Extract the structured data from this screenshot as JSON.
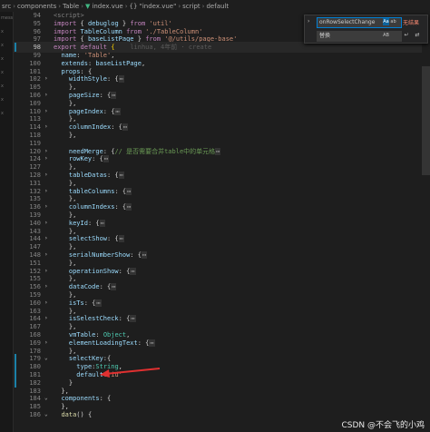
{
  "breadcrumb": [
    "src",
    "components",
    "Table",
    "index.vue",
    "{} \"index.vue\"",
    "script",
    "default"
  ],
  "sidebar_text": [
    "messa",
    "x",
    "x",
    "x",
    "x",
    "x",
    "x",
    "x"
  ],
  "find_widget": {
    "search_value": "onRowSelectChange",
    "options": [
      "Aa",
      "ab",
      ".*"
    ],
    "status": "无结果",
    "replace_value": "替换",
    "replace_options": [
      "AB"
    ]
  },
  "lines": [
    {
      "n": "94",
      "tokens": [
        [
          "tag",
          "<script>"
        ]
      ]
    },
    {
      "n": "95",
      "tokens": [
        [
          "kw",
          "import"
        ],
        [
          "punc",
          " { "
        ],
        [
          "var",
          "debuglog"
        ],
        [
          "punc",
          " } "
        ],
        [
          "kw",
          "from"
        ],
        [
          "punc",
          " "
        ],
        [
          "str",
          "'util'"
        ]
      ]
    },
    {
      "n": "96",
      "tokens": [
        [
          "kw",
          "import"
        ],
        [
          "punc",
          " "
        ],
        [
          "var",
          "TableColumn"
        ],
        [
          "punc",
          " "
        ],
        [
          "kw",
          "from"
        ],
        [
          "punc",
          " "
        ],
        [
          "str",
          "'./TableColumn'"
        ]
      ]
    },
    {
      "n": "97",
      "tokens": [
        [
          "kw",
          "import"
        ],
        [
          "punc",
          " { "
        ],
        [
          "var",
          "baseListPage"
        ],
        [
          "punc",
          " } "
        ],
        [
          "kw",
          "from"
        ],
        [
          "punc",
          " "
        ],
        [
          "str",
          "'@/utils/page-base'"
        ]
      ]
    },
    {
      "n": "98",
      "cur": true,
      "tokens": [
        [
          "kw",
          "export"
        ],
        [
          "punc",
          " "
        ],
        [
          "kw",
          "default"
        ],
        [
          "punc",
          " "
        ],
        [
          "b1",
          "{"
        ],
        [
          "ghost",
          "    linhua, 4年前 · create"
        ]
      ]
    },
    {
      "n": "99",
      "tokens": [
        [
          "punc",
          "  "
        ],
        [
          "var",
          "name"
        ],
        [
          "punc",
          ": "
        ],
        [
          "str",
          "'Table'"
        ],
        [
          "punc",
          ","
        ]
      ]
    },
    {
      "n": "100",
      "tokens": [
        [
          "punc",
          "  "
        ],
        [
          "var",
          "extends"
        ],
        [
          "punc",
          ": "
        ],
        [
          "var",
          "baseListPage"
        ],
        [
          "punc",
          ","
        ]
      ]
    },
    {
      "n": "101",
      "tokens": [
        [
          "punc",
          "  "
        ],
        [
          "var",
          "props"
        ],
        [
          "punc",
          ": {"
        ]
      ]
    },
    {
      "n": "102",
      "fold": ">",
      "tokens": [
        [
          "punc",
          "    "
        ],
        [
          "var",
          "widthStyle"
        ],
        [
          "punc",
          ": {"
        ],
        [
          "coll",
          "⋯"
        ]
      ]
    },
    {
      "n": "105",
      "tokens": [
        [
          "punc",
          "    },"
        ]
      ]
    },
    {
      "n": "106",
      "fold": ">",
      "tokens": [
        [
          "punc",
          "    "
        ],
        [
          "var",
          "pageSize"
        ],
        [
          "punc",
          ": {"
        ],
        [
          "coll",
          "⋯"
        ]
      ]
    },
    {
      "n": "109",
      "tokens": [
        [
          "punc",
          "    },"
        ]
      ]
    },
    {
      "n": "110",
      "fold": ">",
      "tokens": [
        [
          "punc",
          "    "
        ],
        [
          "var",
          "pageIndex"
        ],
        [
          "punc",
          ": {"
        ],
        [
          "coll",
          "⋯"
        ]
      ]
    },
    {
      "n": "113",
      "tokens": [
        [
          "punc",
          "    },"
        ]
      ]
    },
    {
      "n": "114",
      "fold": ">",
      "tokens": [
        [
          "punc",
          "    "
        ],
        [
          "var",
          "columnIndex"
        ],
        [
          "punc",
          ": {"
        ],
        [
          "coll",
          "⋯"
        ]
      ]
    },
    {
      "n": "118",
      "tokens": [
        [
          "punc",
          "    },"
        ]
      ]
    },
    {
      "n": "119",
      "tokens": []
    },
    {
      "n": "120",
      "fold": ">",
      "tokens": [
        [
          "punc",
          "    "
        ],
        [
          "var",
          "needMerge"
        ],
        [
          "punc",
          ": {"
        ],
        [
          "cmt",
          "// 是否需要合并table中的单元格"
        ],
        [
          "coll",
          "⋯"
        ]
      ]
    },
    {
      "n": "124",
      "fold": ">",
      "tokens": [
        [
          "punc",
          "    "
        ],
        [
          "var",
          "rowKey"
        ],
        [
          "punc",
          ": {"
        ],
        [
          "coll",
          "⋯"
        ]
      ]
    },
    {
      "n": "127",
      "tokens": [
        [
          "punc",
          "    },"
        ]
      ]
    },
    {
      "n": "128",
      "fold": ">",
      "tokens": [
        [
          "punc",
          "    "
        ],
        [
          "var",
          "tableDatas"
        ],
        [
          "punc",
          ": {"
        ],
        [
          "coll",
          "⋯"
        ]
      ]
    },
    {
      "n": "131",
      "tokens": [
        [
          "punc",
          "    },"
        ]
      ]
    },
    {
      "n": "132",
      "fold": ">",
      "tokens": [
        [
          "punc",
          "    "
        ],
        [
          "var",
          "tableColumns"
        ],
        [
          "punc",
          ": {"
        ],
        [
          "coll",
          "⋯"
        ]
      ]
    },
    {
      "n": "135",
      "tokens": [
        [
          "punc",
          "    },"
        ]
      ]
    },
    {
      "n": "136",
      "fold": ">",
      "tokens": [
        [
          "punc",
          "    "
        ],
        [
          "var",
          "columnIndexs"
        ],
        [
          "punc",
          ": {"
        ],
        [
          "coll",
          "⋯"
        ]
      ]
    },
    {
      "n": "139",
      "tokens": [
        [
          "punc",
          "    },"
        ]
      ]
    },
    {
      "n": "140",
      "fold": ">",
      "tokens": [
        [
          "punc",
          "    "
        ],
        [
          "var",
          "keyId"
        ],
        [
          "punc",
          ": {"
        ],
        [
          "coll",
          "⋯"
        ]
      ]
    },
    {
      "n": "143",
      "tokens": [
        [
          "punc",
          "    },"
        ]
      ]
    },
    {
      "n": "144",
      "fold": ">",
      "tokens": [
        [
          "punc",
          "    "
        ],
        [
          "var",
          "selectShow"
        ],
        [
          "punc",
          ": {"
        ],
        [
          "coll",
          "⋯"
        ]
      ]
    },
    {
      "n": "147",
      "tokens": [
        [
          "punc",
          "    },"
        ]
      ]
    },
    {
      "n": "148",
      "fold": ">",
      "tokens": [
        [
          "punc",
          "    "
        ],
        [
          "var",
          "serialNumberShow"
        ],
        [
          "punc",
          ": {"
        ],
        [
          "coll",
          "⋯"
        ]
      ]
    },
    {
      "n": "151",
      "tokens": [
        [
          "punc",
          "    },"
        ]
      ]
    },
    {
      "n": "152",
      "fold": ">",
      "tokens": [
        [
          "punc",
          "    "
        ],
        [
          "var",
          "operationShow"
        ],
        [
          "punc",
          ": {"
        ],
        [
          "coll",
          "⋯"
        ]
      ]
    },
    {
      "n": "155",
      "tokens": [
        [
          "punc",
          "    },"
        ]
      ]
    },
    {
      "n": "156",
      "fold": ">",
      "tokens": [
        [
          "punc",
          "    "
        ],
        [
          "var",
          "dataCode"
        ],
        [
          "punc",
          ": {"
        ],
        [
          "coll",
          "⋯"
        ]
      ]
    },
    {
      "n": "159",
      "tokens": [
        [
          "punc",
          "    },"
        ]
      ]
    },
    {
      "n": "160",
      "fold": ">",
      "tokens": [
        [
          "punc",
          "    "
        ],
        [
          "var",
          "isTs"
        ],
        [
          "punc",
          ": {"
        ],
        [
          "coll",
          "⋯"
        ]
      ]
    },
    {
      "n": "163",
      "tokens": [
        [
          "punc",
          "    },"
        ]
      ]
    },
    {
      "n": "164",
      "fold": ">",
      "tokens": [
        [
          "punc",
          "    "
        ],
        [
          "var",
          "isSelestCheck"
        ],
        [
          "punc",
          ": {"
        ],
        [
          "coll",
          "⋯"
        ]
      ]
    },
    {
      "n": "167",
      "tokens": [
        [
          "punc",
          "    },"
        ]
      ]
    },
    {
      "n": "168",
      "tokens": [
        [
          "punc",
          "    "
        ],
        [
          "var",
          "vmTable"
        ],
        [
          "punc",
          ": "
        ],
        [
          "cls",
          "Object"
        ],
        [
          "punc",
          ","
        ]
      ]
    },
    {
      "n": "169",
      "fold": ">",
      "tokens": [
        [
          "punc",
          "    "
        ],
        [
          "var",
          "elementLoadingText"
        ],
        [
          "punc",
          ": {"
        ],
        [
          "coll",
          "⋯"
        ]
      ]
    },
    {
      "n": "178",
      "tokens": [
        [
          "punc",
          "    },"
        ]
      ]
    },
    {
      "n": "179",
      "fold": "v",
      "tokens": [
        [
          "punc",
          "    "
        ],
        [
          "var",
          "selectKey"
        ],
        [
          "punc",
          ":{"
        ]
      ]
    },
    {
      "n": "180",
      "tokens": [
        [
          "punc",
          "      "
        ],
        [
          "var",
          "type"
        ],
        [
          "punc",
          ":"
        ],
        [
          "cls",
          "String"
        ],
        [
          "punc",
          ","
        ]
      ]
    },
    {
      "n": "181",
      "tokens": [
        [
          "punc",
          "      "
        ],
        [
          "var",
          "default"
        ],
        [
          "punc",
          ":"
        ],
        [
          "str",
          "'id'"
        ]
      ]
    },
    {
      "n": "182",
      "tokens": [
        [
          "punc",
          "    }"
        ]
      ]
    },
    {
      "n": "183",
      "tokens": [
        [
          "punc",
          "  },"
        ]
      ]
    },
    {
      "n": "184",
      "fold": "v",
      "tokens": [
        [
          "punc",
          "  "
        ],
        [
          "var",
          "components"
        ],
        [
          "punc",
          ": {"
        ]
      ]
    },
    {
      "n": "185",
      "tokens": [
        [
          "punc",
          "  },"
        ]
      ]
    },
    {
      "n": "186",
      "fold": "v",
      "tokens": [
        [
          "punc",
          "  "
        ],
        [
          "fn",
          "data"
        ],
        [
          "punc",
          "() {"
        ]
      ]
    }
  ],
  "watermark": "CSDN @不会飞的小鸡",
  "colors": {
    "arrow": "#e03030",
    "accent": "#007fd4"
  }
}
